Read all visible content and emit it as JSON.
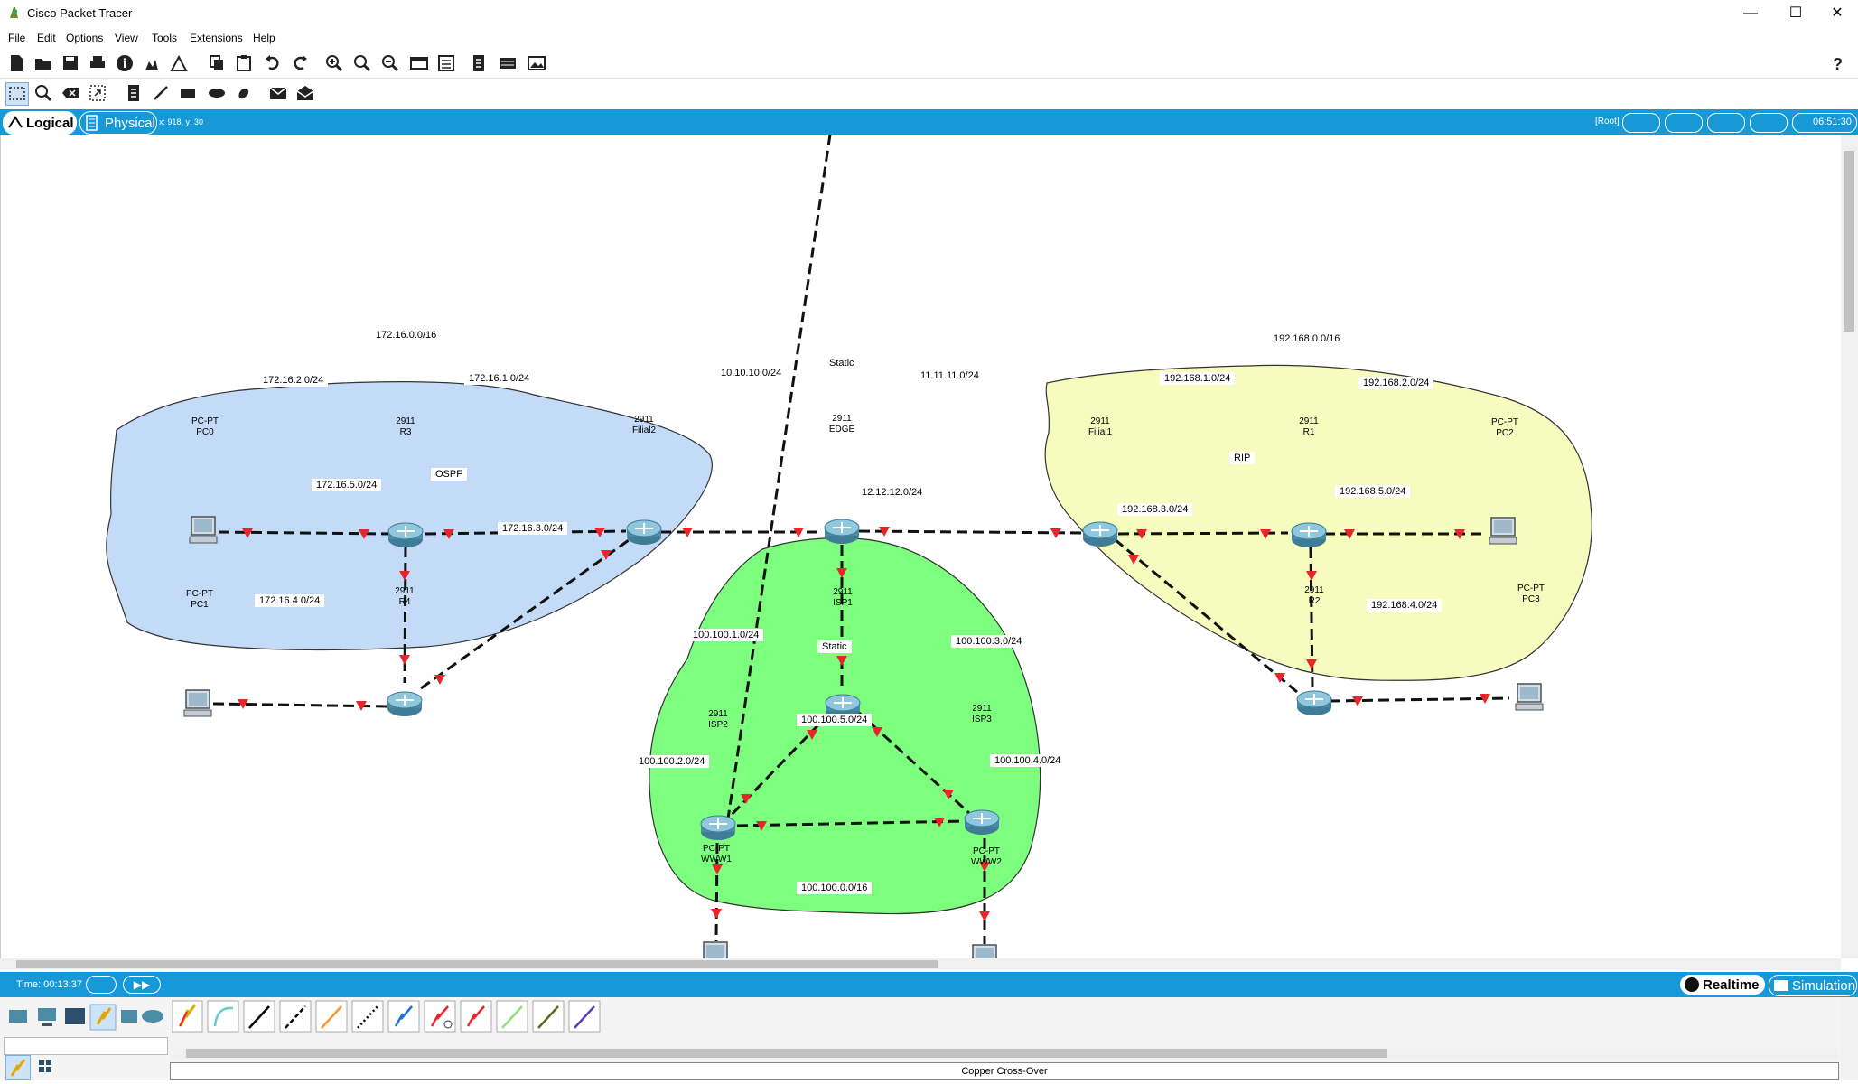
{
  "window": {
    "title": "Cisco Packet Tracer",
    "minimize": "—",
    "maximize": "☐",
    "close": "✕"
  },
  "menu": [
    "File",
    "Edit",
    "Options",
    "View",
    "Tools",
    "Extensions",
    "Help"
  ],
  "workspace": {
    "logical_label": "Logical",
    "physical_label": "Physical",
    "coords": "x: 918, y: 30",
    "root_label": "[Root]",
    "clock": "06:51:30"
  },
  "network": {
    "regions": [
      {
        "name": "ospf-area",
        "label": "172.16.0.0/16",
        "protocol": "OSPF",
        "color": "#c3dbf7"
      },
      {
        "name": "static-area",
        "label": "100.100.0.0/16",
        "protocol": "Static",
        "color": "#7dfe7f"
      },
      {
        "name": "rip-area",
        "label": "192.168.0.0/16",
        "protocol": "RIP",
        "color": "#f5fcbe"
      }
    ],
    "edge_static_label": "Static",
    "devices": {
      "pc0": {
        "type": "PC-PT",
        "name": "PC0"
      },
      "r3": {
        "type": "2911",
        "name": "R3"
      },
      "filial2": {
        "type": "2911",
        "name": "Filial2"
      },
      "pc1": {
        "type": "PC-PT",
        "name": "PC1"
      },
      "r4": {
        "type": "2911",
        "name": "R4"
      },
      "edge": {
        "type": "2911",
        "name": "EDGE"
      },
      "filial1": {
        "type": "2911",
        "name": "Filial1"
      },
      "r1": {
        "type": "2911",
        "name": "R1"
      },
      "pc2": {
        "type": "PC-PT",
        "name": "PC2"
      },
      "r2": {
        "type": "2911",
        "name": "R2"
      },
      "pc3": {
        "type": "PC-PT",
        "name": "PC3"
      },
      "isp1": {
        "type": "2911",
        "name": "ISP1"
      },
      "isp2": {
        "type": "2911",
        "name": "ISP2"
      },
      "isp3": {
        "type": "2911",
        "name": "ISP3"
      },
      "www1": {
        "type": "PC-PT",
        "name": "WWW1"
      },
      "www2": {
        "type": "PC-PT",
        "name": "WWW2"
      }
    },
    "links": [
      {
        "from": "pc0",
        "to": "r3",
        "label": "172.16.2.0/24"
      },
      {
        "from": "r3",
        "to": "filial2",
        "label": "172.16.1.0/24"
      },
      {
        "from": "r3",
        "to": "r4",
        "label": "172.16.5.0/24"
      },
      {
        "from": "r4",
        "to": "filial2",
        "label": "172.16.3.0/24"
      },
      {
        "from": "pc1",
        "to": "r4",
        "label": "172.16.4.0/24"
      },
      {
        "from": "filial2",
        "to": "edge",
        "label": "10.10.10.0/24"
      },
      {
        "from": "edge",
        "to": "filial1",
        "label": "11.11.11.0/24"
      },
      {
        "from": "edge",
        "to": "isp1",
        "label": "12.12.12.0/24"
      },
      {
        "from": "filial1",
        "to": "r1",
        "label": "192.168.1.0/24"
      },
      {
        "from": "r1",
        "to": "pc2",
        "label": "192.168.2.0/24"
      },
      {
        "from": "filial1",
        "to": "r2",
        "label": "192.168.3.0/24"
      },
      {
        "from": "r1",
        "to": "r2",
        "label": "192.168.5.0/24"
      },
      {
        "from": "r2",
        "to": "pc3",
        "label": "192.168.4.0/24"
      },
      {
        "from": "isp1",
        "to": "isp2",
        "label": "100.100.1.0/24"
      },
      {
        "from": "isp1",
        "to": "isp3",
        "label": "100.100.3.0/24"
      },
      {
        "from": "isp2",
        "to": "isp3",
        "label": "100.100.5.0/24"
      },
      {
        "from": "isp2",
        "to": "www1",
        "label": "100.100.2.0/24"
      },
      {
        "from": "isp3",
        "to": "www2",
        "label": "100.100.4.0/24"
      }
    ]
  },
  "bottom": {
    "time": "Time: 00:13:37",
    "realtime": "Realtime",
    "simulation": "Simulation",
    "status": "Copper Cross-Over"
  }
}
